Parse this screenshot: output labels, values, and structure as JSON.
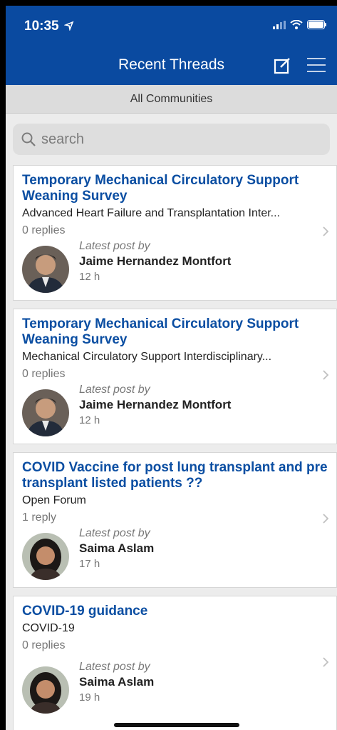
{
  "status": {
    "time": "10:35"
  },
  "header": {
    "title": "Recent Threads"
  },
  "filter": {
    "label": "All Communities"
  },
  "search": {
    "placeholder": "search"
  },
  "threads": [
    {
      "title": "Temporary Mechanical Circulatory Support Weaning Survey",
      "community": "Advanced Heart Failure and Transplantation Inter...",
      "replies": "0 replies",
      "latest_label": "Latest post by",
      "author": "Jaime Hernandez Montfort",
      "time": "12 h"
    },
    {
      "title": "Temporary Mechanical Circulatory Support Weaning Survey",
      "community": "Mechanical Circulatory Support Interdisciplinary...",
      "replies": "0 replies",
      "latest_label": "Latest post by",
      "author": "Jaime Hernandez Montfort",
      "time": "12 h"
    },
    {
      "title": "COVID Vaccine for post lung transplant and pre transplant listed patients ??",
      "community": "Open Forum",
      "replies": "1 reply",
      "latest_label": "Latest post by",
      "author": "Saima Aslam",
      "time": "17 h"
    },
    {
      "title": "COVID-19 guidance",
      "community": "COVID-19",
      "replies": "0 replies",
      "latest_label": "Latest post by",
      "author": "Saima Aslam",
      "time": "19 h"
    }
  ],
  "colors": {
    "header_bg": "#0a4aa0",
    "title_link": "#0b4ea2"
  },
  "icons": [
    "location-arrow-icon",
    "signal-icon",
    "wifi-icon",
    "battery-icon",
    "compose-icon",
    "menu-icon",
    "search-icon",
    "chevron-right-icon"
  ]
}
